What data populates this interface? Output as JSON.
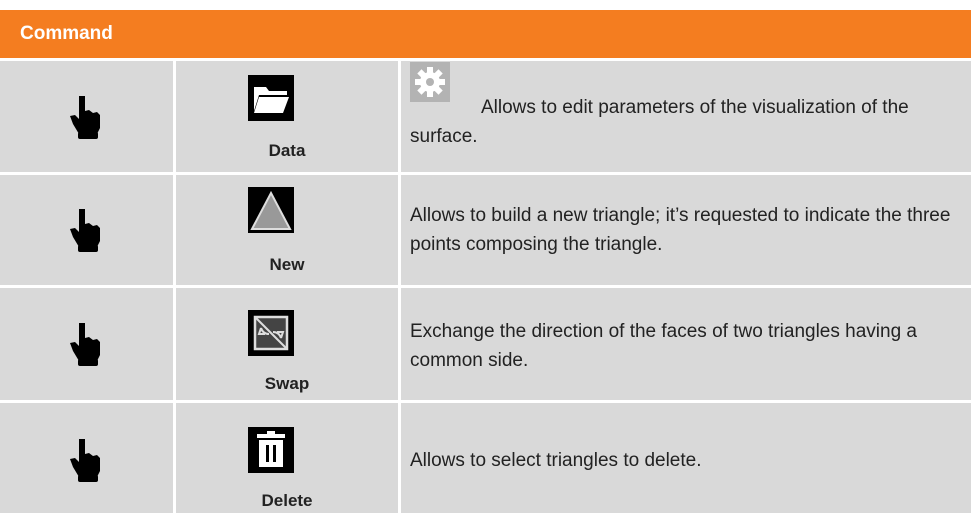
{
  "header": {
    "title": "Command"
  },
  "rows": [
    {
      "icon": "folder-icon",
      "label": "Data",
      "description": "Allows to edit parameters of the visualization of the surface.",
      "leading_icon": "gear-icon"
    },
    {
      "icon": "triangle-icon",
      "label": "New",
      "description": "Allows to build a new triangle; it’s requested to indicate the three points composing the triangle."
    },
    {
      "icon": "swap-icon",
      "label": "Swap",
      "description": "Exchange the direction of the faces of two triangles having a common side."
    },
    {
      "icon": "trash-icon",
      "label": "Delete",
      "description": "Allows to select triangles to delete."
    }
  ],
  "colors": {
    "header_bg": "#f47d20",
    "cell_bg": "#d9d9d9",
    "icon_bg": "#000000",
    "gear_bg": "#b3b3b3"
  }
}
